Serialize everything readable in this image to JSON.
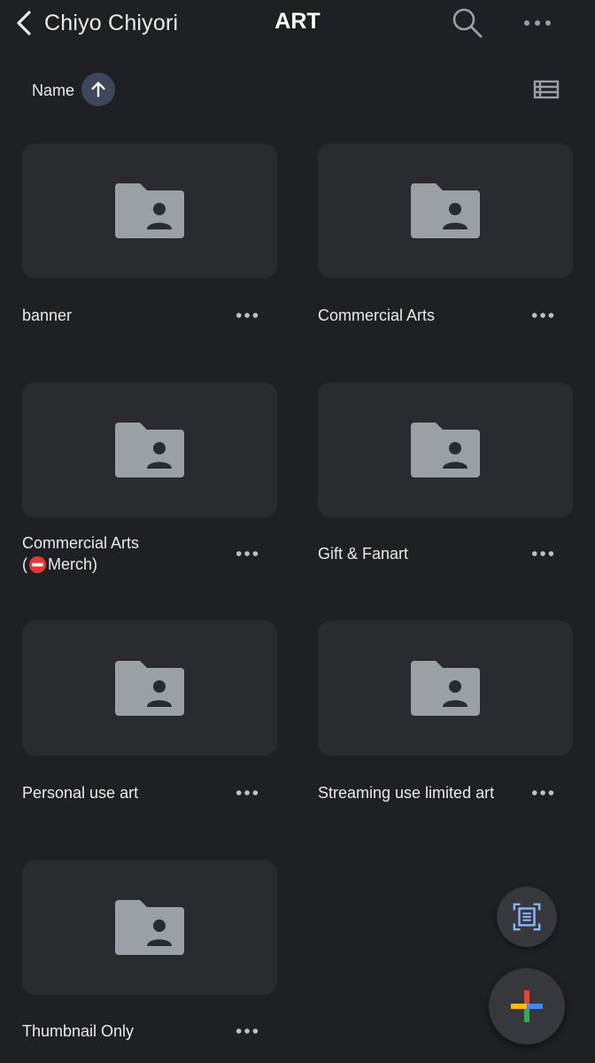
{
  "header": {
    "back_label": "Chiyo Chiyori",
    "title": "ART",
    "back_icon": "chevron-left-icon",
    "search_icon": "search-icon",
    "more_icon": "more-horizontal-icon"
  },
  "sort": {
    "label": "Name",
    "direction_icon": "arrow-up-icon",
    "view_icon": "list-view-icon"
  },
  "folders": [
    {
      "name": "banner"
    },
    {
      "name": "Commercial Arts"
    },
    {
      "name_line1": "Commercial Arts",
      "name_line2_suffix": " Merch)",
      "name_line2_prefix": "(",
      "badge_icon": "no-entry-icon"
    },
    {
      "name": "Gift & Fanart"
    },
    {
      "name": "Personal use art"
    },
    {
      "name": "Streaming use limited art"
    },
    {
      "name": "Thumbnail Only"
    }
  ],
  "folder_icon": "shared-folder-icon",
  "fabs": {
    "scan_icon": "document-scan-icon",
    "new_icon": "plus-icon"
  },
  "colors": {
    "background": "#1f2023",
    "tile": "#2a2b2e",
    "folder_glyph": "#9aa0a6",
    "sort_pill": "#3d4759",
    "google_blue": "#4285f4",
    "google_red": "#ea4335",
    "google_yellow": "#fbbc04",
    "google_green": "#34a853"
  }
}
